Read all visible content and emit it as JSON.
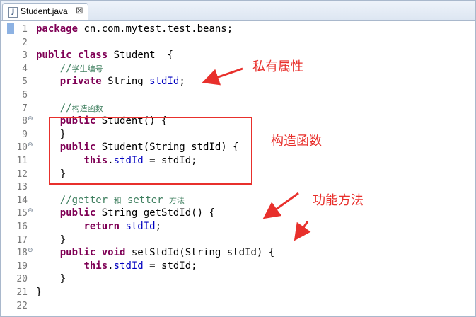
{
  "tab": {
    "icon_label": "J",
    "title": "Student.java",
    "close_glyph": "⊠"
  },
  "lines": [
    {
      "n": "1",
      "fold": "",
      "parts": [
        {
          "t": "kw",
          "v": "package"
        },
        {
          "t": "",
          "v": " cn.com.mytest.test.beans;"
        }
      ],
      "cursor": true
    },
    {
      "n": "2",
      "fold": "",
      "parts": []
    },
    {
      "n": "3",
      "fold": "",
      "parts": [
        {
          "t": "kw",
          "v": "public"
        },
        {
          "t": "",
          "v": " "
        },
        {
          "t": "kw",
          "v": "class"
        },
        {
          "t": "",
          "v": " Student  {"
        }
      ]
    },
    {
      "n": "4",
      "fold": "",
      "parts": [
        {
          "t": "cmt",
          "v": "    //"
        },
        {
          "t": "cmt cjk",
          "v": "学生编号"
        }
      ]
    },
    {
      "n": "5",
      "fold": "",
      "parts": [
        {
          "t": "",
          "v": "    "
        },
        {
          "t": "kw",
          "v": "private"
        },
        {
          "t": "",
          "v": " String "
        },
        {
          "t": "fld",
          "v": "stdId"
        },
        {
          "t": "",
          "v": ";"
        }
      ]
    },
    {
      "n": "6",
      "fold": "",
      "parts": []
    },
    {
      "n": "7",
      "fold": "",
      "parts": [
        {
          "t": "cmt",
          "v": "    //"
        },
        {
          "t": "cmt cjk",
          "v": "构造函数"
        }
      ]
    },
    {
      "n": "8",
      "fold": "⊖",
      "parts": [
        {
          "t": "",
          "v": "    "
        },
        {
          "t": "kw",
          "v": "public"
        },
        {
          "t": "",
          "v": " Student() {"
        }
      ]
    },
    {
      "n": "9",
      "fold": "",
      "parts": [
        {
          "t": "",
          "v": "    }"
        }
      ]
    },
    {
      "n": "10",
      "fold": "⊖",
      "parts": [
        {
          "t": "",
          "v": "    "
        },
        {
          "t": "kw",
          "v": "public"
        },
        {
          "t": "",
          "v": " Student(String stdId) {"
        }
      ]
    },
    {
      "n": "11",
      "fold": "",
      "parts": [
        {
          "t": "",
          "v": "        "
        },
        {
          "t": "kw",
          "v": "this"
        },
        {
          "t": "",
          "v": "."
        },
        {
          "t": "fld",
          "v": "stdId"
        },
        {
          "t": "",
          "v": " = stdId;"
        }
      ]
    },
    {
      "n": "12",
      "fold": "",
      "parts": [
        {
          "t": "",
          "v": "    }"
        }
      ]
    },
    {
      "n": "13",
      "fold": "",
      "parts": []
    },
    {
      "n": "14",
      "fold": "",
      "parts": [
        {
          "t": "cmt",
          "v": "    //getter "
        },
        {
          "t": "cmt cjk",
          "v": "和"
        },
        {
          "t": "cmt",
          "v": " setter "
        },
        {
          "t": "cmt cjk",
          "v": "方法"
        }
      ]
    },
    {
      "n": "15",
      "fold": "⊖",
      "parts": [
        {
          "t": "",
          "v": "    "
        },
        {
          "t": "kw",
          "v": "public"
        },
        {
          "t": "",
          "v": " String getStdId() {"
        }
      ]
    },
    {
      "n": "16",
      "fold": "",
      "parts": [
        {
          "t": "",
          "v": "        "
        },
        {
          "t": "kw",
          "v": "return"
        },
        {
          "t": "",
          "v": " "
        },
        {
          "t": "fld",
          "v": "stdId"
        },
        {
          "t": "",
          "v": ";"
        }
      ]
    },
    {
      "n": "17",
      "fold": "",
      "parts": [
        {
          "t": "",
          "v": "    }"
        }
      ]
    },
    {
      "n": "18",
      "fold": "⊖",
      "parts": [
        {
          "t": "",
          "v": "    "
        },
        {
          "t": "kw",
          "v": "public"
        },
        {
          "t": "",
          "v": " "
        },
        {
          "t": "kw",
          "v": "void"
        },
        {
          "t": "",
          "v": " setStdId(String stdId) {"
        }
      ]
    },
    {
      "n": "19",
      "fold": "",
      "parts": [
        {
          "t": "",
          "v": "        "
        },
        {
          "t": "kw",
          "v": "this"
        },
        {
          "t": "",
          "v": "."
        },
        {
          "t": "fld",
          "v": "stdId"
        },
        {
          "t": "",
          "v": " = stdId;"
        }
      ]
    },
    {
      "n": "20",
      "fold": "",
      "parts": [
        {
          "t": "",
          "v": "    }"
        }
      ]
    },
    {
      "n": "21",
      "fold": "",
      "parts": [
        {
          "t": "",
          "v": "}"
        }
      ]
    },
    {
      "n": "22",
      "fold": "",
      "parts": []
    }
  ],
  "annotations": {
    "private_fields": "私有属性",
    "constructors": "构造函数",
    "methods": "功能方法"
  },
  "colors": {
    "annotation": "#e8302c",
    "keyword": "#7f0055",
    "field": "#0000c0",
    "comment": "#3f7f5f"
  }
}
